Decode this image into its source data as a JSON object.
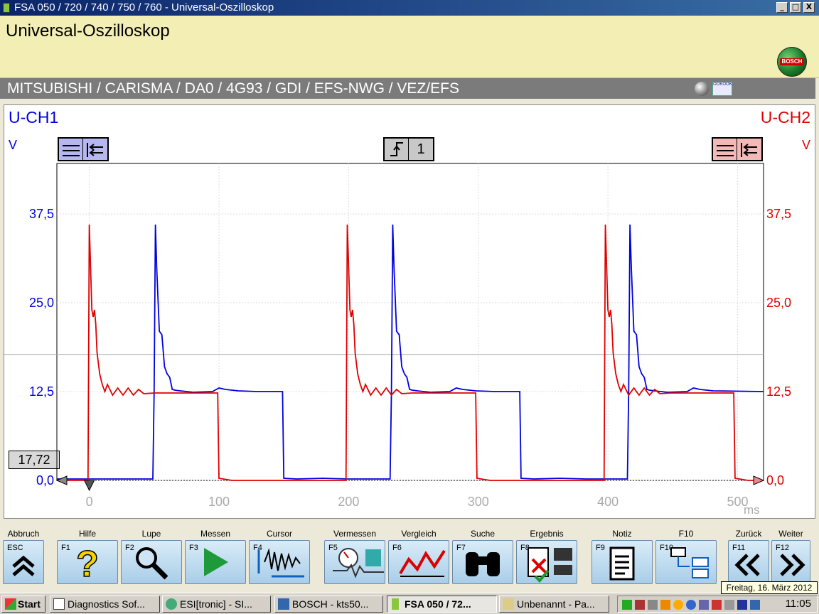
{
  "window": {
    "title": "FSA 050 / 720 / 740 / 750 / 760 - Universal-Oszilloskop",
    "min": "_",
    "max": "□",
    "close": "X"
  },
  "header": {
    "title": "Universal-Oszilloskop",
    "logo_text": "BOSCH"
  },
  "vehicle": {
    "path": "MITSUBISHI / CARISMA / DA0 / 4G93 / GDI / EFS-NWG / VEZ/EFS",
    "grid_icon_text": "OOKOOK"
  },
  "scope": {
    "ch1_label": "U-CH1",
    "ch2_label": "U-CH2",
    "ch1_unit": "V",
    "ch2_unit": "V",
    "trigger_value": "1",
    "cursor_value": "17,72",
    "x_unit": "ms",
    "ch1_color": "#0000e0",
    "ch2_color": "#e00000"
  },
  "chart_data": {
    "type": "line",
    "title": "",
    "xlabel": "ms",
    "ylabel": "V",
    "xlim": [
      -25,
      520
    ],
    "ylim": [
      0,
      50
    ],
    "x_ticks": [
      "0",
      "100",
      "200",
      "300",
      "400",
      "500"
    ],
    "y_ticks_left": [
      "37,5",
      "25,0",
      "12,5",
      "0,0"
    ],
    "y_ticks_right": [
      "37,5",
      "25,0",
      "12,5",
      "0,0"
    ],
    "y_tick_values": [
      37.5,
      25.0,
      12.5,
      0.0
    ],
    "x_tick_values": [
      0,
      100,
      200,
      300,
      400,
      500
    ],
    "cursor_y": 17.72,
    "series": [
      {
        "name": "U-CH1",
        "color": "#0000e0",
        "x": [
          -25,
          49,
          50,
          51,
          52,
          54,
          56,
          58,
          60,
          62,
          64,
          66,
          70,
          80,
          95,
          100,
          105,
          115,
          130,
          149,
          150,
          160,
          180,
          199,
          232,
          233,
          234,
          235,
          237,
          239,
          241,
          243,
          245,
          247,
          249,
          253,
          263,
          278,
          283,
          288,
          298,
          313,
          332,
          333,
          343,
          363,
          383,
          415,
          416,
          417,
          418,
          420,
          422,
          424,
          426,
          428,
          430,
          432,
          436,
          446,
          461,
          466,
          471,
          481,
          520
        ],
        "y": [
          0.2,
          0.2,
          12.5,
          36.0,
          30.0,
          21.0,
          20.5,
          16.0,
          15.0,
          14.5,
          12.8,
          12.7,
          12.6,
          12.4,
          12.5,
          13.0,
          12.8,
          12.6,
          12.5,
          12.5,
          0.3,
          0.2,
          0.3,
          0.2,
          0.2,
          12.5,
          36.0,
          30.0,
          21.0,
          20.5,
          16.0,
          15.0,
          14.5,
          12.8,
          12.7,
          12.6,
          12.4,
          12.5,
          13.0,
          12.8,
          12.6,
          12.5,
          12.5,
          0.3,
          0.2,
          0.3,
          0.2,
          0.2,
          12.5,
          36.0,
          30.0,
          21.0,
          20.5,
          16.0,
          15.0,
          14.5,
          12.8,
          12.7,
          12.6,
          12.4,
          12.5,
          13.0,
          12.8,
          12.6,
          12.5
        ]
      },
      {
        "name": "U-CH2",
        "color": "#e00000",
        "x": [
          -25,
          -1,
          0,
          1,
          2,
          3,
          4,
          5,
          6,
          8,
          10,
          12,
          14,
          18,
          22,
          26,
          30,
          34,
          38,
          42,
          50,
          70,
          99,
          100,
          110,
          150,
          198,
          199,
          200,
          201,
          202,
          203,
          204,
          205,
          207,
          209,
          211,
          213,
          217,
          221,
          225,
          229,
          233,
          237,
          241,
          249,
          269,
          298,
          299,
          309,
          349,
          397,
          398,
          399,
          400,
          401,
          402,
          403,
          404,
          406,
          408,
          410,
          412,
          416,
          420,
          424,
          428,
          432,
          436,
          440,
          448,
          468,
          497,
          498,
          508,
          520
        ],
        "y": [
          0.0,
          0.0,
          36.0,
          30.0,
          24.0,
          23.0,
          24.0,
          22.0,
          18.0,
          15.0,
          13.5,
          12.5,
          13.5,
          12.0,
          13.0,
          12.0,
          13.0,
          12.0,
          12.8,
          12.2,
          12.3,
          12.3,
          12.3,
          0.3,
          0.0,
          0.0,
          0.0,
          36.0,
          30.0,
          24.0,
          23.0,
          24.0,
          22.0,
          18.0,
          15.0,
          13.5,
          12.5,
          13.5,
          12.0,
          13.0,
          12.0,
          13.0,
          12.0,
          12.8,
          12.2,
          12.3,
          12.3,
          12.3,
          0.3,
          0.0,
          0.0,
          0.0,
          36.0,
          30.0,
          24.0,
          23.0,
          24.0,
          22.0,
          18.0,
          15.0,
          13.5,
          12.5,
          13.5,
          12.0,
          13.0,
          12.0,
          13.0,
          12.0,
          12.8,
          12.2,
          12.3,
          12.3,
          12.3,
          0.3,
          0.0,
          0.0
        ]
      }
    ]
  },
  "fkeys": [
    {
      "label": "Abbruch",
      "key": "ESC",
      "icon": "double-chevron-up-icon"
    },
    {
      "label": "Hilfe",
      "key": "F1",
      "icon": "question-icon"
    },
    {
      "label": "Lupe",
      "key": "F2",
      "icon": "magnifier-icon"
    },
    {
      "label": "Messen",
      "key": "F3",
      "icon": "play-icon"
    },
    {
      "label": "Cursor",
      "key": "F4",
      "icon": "cursor-wave-icon"
    },
    {
      "label": "Vermessen",
      "key": "F5",
      "icon": "gauge-wave-icon"
    },
    {
      "label": "Vergleich",
      "key": "F6",
      "icon": "compare-curve-icon"
    },
    {
      "label": "Suche",
      "key": "F7",
      "icon": "binoculars-icon"
    },
    {
      "label": "Ergebnis",
      "key": "F8",
      "icon": "result-print-icon"
    },
    {
      "label": "Notiz",
      "key": "F9",
      "icon": "note-icon"
    },
    {
      "label": "F10",
      "key": "F10",
      "icon": "tree-icon"
    },
    {
      "label": "Zurück",
      "key": "F11",
      "icon": "double-chevron-left-icon"
    },
    {
      "label": "Weiter",
      "key": "F12",
      "icon": "double-chevron-right-icon"
    }
  ],
  "taskbar": {
    "start": "Start",
    "items": [
      {
        "label": "Diagnostics Sof..."
      },
      {
        "label": "ESI[tronic] - SI..."
      },
      {
        "label": "BOSCH - kts50..."
      },
      {
        "label": "FSA 050 / 72..."
      },
      {
        "label": "Unbenannt - Pa..."
      }
    ],
    "clock": "11:05",
    "tooltip": "Freitag, 16. März 2012"
  }
}
